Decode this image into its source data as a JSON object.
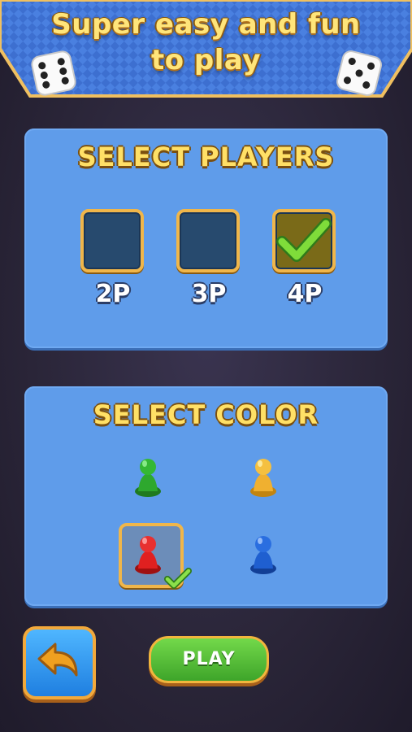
{
  "banner": {
    "line1": "Super easy and fun",
    "line2": "to play"
  },
  "players": {
    "title": "SELECT PLAYERS",
    "options": [
      {
        "label": "2P",
        "selected": false
      },
      {
        "label": "3P",
        "selected": false
      },
      {
        "label": "4P",
        "selected": true
      }
    ]
  },
  "color": {
    "title": "SELECT COLOR",
    "options": [
      {
        "name": "green",
        "color": "#2ea82e",
        "selected": false
      },
      {
        "name": "yellow",
        "color": "#f0b030",
        "selected": false
      },
      {
        "name": "red",
        "color": "#e02020",
        "selected": true
      },
      {
        "name": "blue",
        "color": "#1f5fd0",
        "selected": false
      }
    ]
  },
  "buttons": {
    "play_label": "PLAY",
    "back_icon": "back-arrow-icon"
  },
  "colors": {
    "panel": "#5f9cea",
    "accent": "#f0b64a",
    "title_yellow": "#ffe066"
  }
}
